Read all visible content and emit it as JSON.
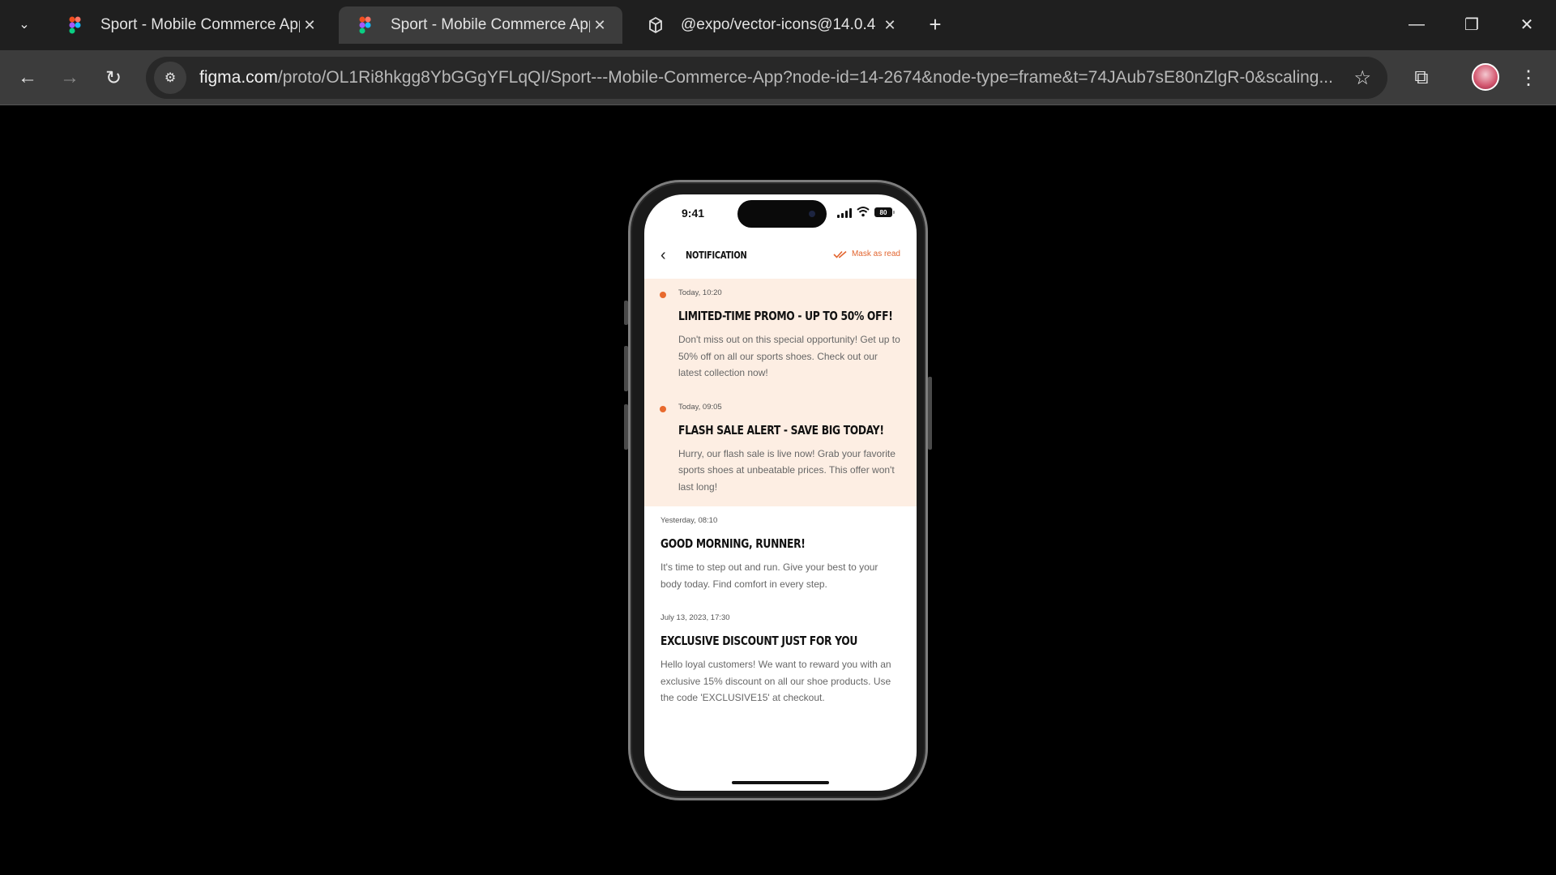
{
  "browser": {
    "tabs": [
      {
        "label": "Sport - Mobile Commerce App",
        "icon": "figma-icon",
        "active": false
      },
      {
        "label": "Sport - Mobile Commerce App",
        "icon": "figma-icon",
        "active": true
      },
      {
        "label": "@expo/vector-icons@14.0.4",
        "icon": "package-icon",
        "active": false
      }
    ],
    "url_host": "figma.com",
    "url_path": "/proto/OL1Ri8hkgg8YbGGgYFLqQI/Sport---Mobile-Commerce-App?node-id=14-2674&node-type=frame&t=74JAub7sE80nZlgR-0&scaling..."
  },
  "phone": {
    "status": {
      "time": "9:41",
      "battery": "80"
    },
    "header": {
      "title": "NOTIFICATION",
      "mark_read": "Mask as read"
    },
    "notifications": [
      {
        "time": "Today, 10:20",
        "title": "LIMITED-TIME PROMO - UP TO 50% OFF!",
        "body": "Don't miss out on this special opportunity! Get up to 50% off on all our sports shoes. Check out our latest collection now!",
        "unread": true
      },
      {
        "time": "Today, 09:05",
        "title": "FLASH SALE ALERT - SAVE BIG TODAY!",
        "body": "Hurry, our flash sale is live now! Grab your favorite sports shoes at unbeatable prices. This offer won't last long!",
        "unread": true
      },
      {
        "time": "Yesterday, 08:10",
        "title": "GOOD MORNING, RUNNER!",
        "body": "It's time to step out and run. Give your best to your body today. Find comfort in every step.",
        "unread": false
      },
      {
        "time": "July 13, 2023, 17:30",
        "title": "EXCLUSIVE DISCOUNT JUST FOR YOU",
        "body": "Hello loyal customers! We want to reward you with an exclusive 15% discount on all our shoe products. Use the code 'EXCLUSIVE15' at checkout.",
        "unread": false
      }
    ]
  },
  "colors": {
    "accent": "#e86a2e",
    "unread_bg": "#fdeee3"
  }
}
